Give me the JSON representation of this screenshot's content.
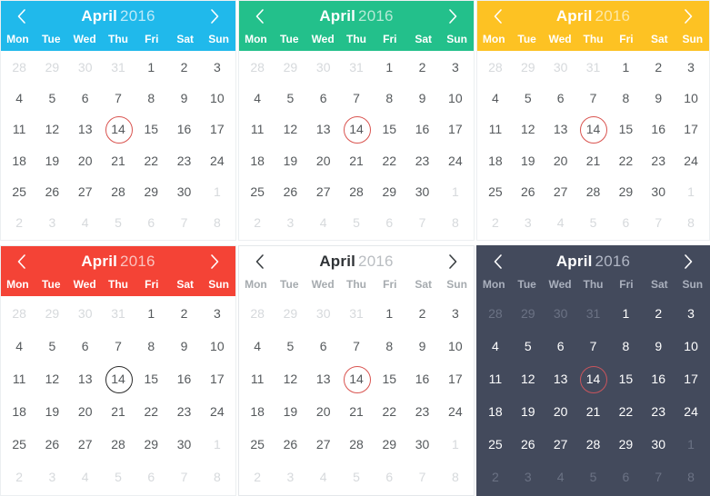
{
  "common": {
    "month_name": "April",
    "year": "2016",
    "prev_icon": "chevron-left-icon",
    "next_icon": "chevron-right-icon",
    "weekdays": [
      "Mon",
      "Tue",
      "Wed",
      "Thu",
      "Fri",
      "Sat",
      "Sun"
    ],
    "weeks": [
      [
        "28",
        "29",
        "30",
        "31",
        "1",
        "2",
        "3"
      ],
      [
        "4",
        "5",
        "6",
        "7",
        "8",
        "9",
        "10"
      ],
      [
        "11",
        "12",
        "13",
        "14",
        "15",
        "16",
        "17"
      ],
      [
        "18",
        "19",
        "20",
        "21",
        "22",
        "23",
        "24"
      ],
      [
        "25",
        "26",
        "27",
        "28",
        "29",
        "30",
        "1"
      ],
      [
        "2",
        "3",
        "4",
        "5",
        "6",
        "7",
        "8"
      ]
    ],
    "muted_cells": [
      [
        true,
        true,
        true,
        true,
        false,
        false,
        false
      ],
      [
        false,
        false,
        false,
        false,
        false,
        false,
        false
      ],
      [
        false,
        false,
        false,
        false,
        false,
        false,
        false
      ],
      [
        false,
        false,
        false,
        false,
        false,
        false,
        false
      ],
      [
        false,
        false,
        false,
        false,
        false,
        false,
        true
      ],
      [
        true,
        true,
        true,
        true,
        true,
        true,
        true
      ]
    ],
    "today": {
      "week": 2,
      "day": 3,
      "value": "14"
    }
  },
  "calendars": [
    {
      "id": "calendar-blue",
      "theme": "blue",
      "month_name": "April",
      "year": "2016",
      "header_color": "#20b9eb",
      "today_ring_color": "#d9534f"
    },
    {
      "id": "calendar-green",
      "theme": "green",
      "month_name": "April",
      "year": "2016",
      "header_color": "#23c08b",
      "today_ring_color": "#d9534f"
    },
    {
      "id": "calendar-yellow",
      "theme": "yellow",
      "month_name": "April",
      "year": "2016",
      "header_color": "#fdc223",
      "today_ring_color": "#d9534f"
    },
    {
      "id": "calendar-red",
      "theme": "red",
      "month_name": "April",
      "year": "2016",
      "header_color": "#f44336",
      "today_ring_color": "#2b2b2b"
    },
    {
      "id": "calendar-light",
      "theme": "light",
      "month_name": "April",
      "year": "2016",
      "header_color": "#ffffff",
      "today_ring_color": "#d9534f"
    },
    {
      "id": "calendar-dark",
      "theme": "dark",
      "month_name": "April",
      "year": "2016",
      "header_color": "#434a5c",
      "today_ring_color": "#c9555c"
    }
  ]
}
